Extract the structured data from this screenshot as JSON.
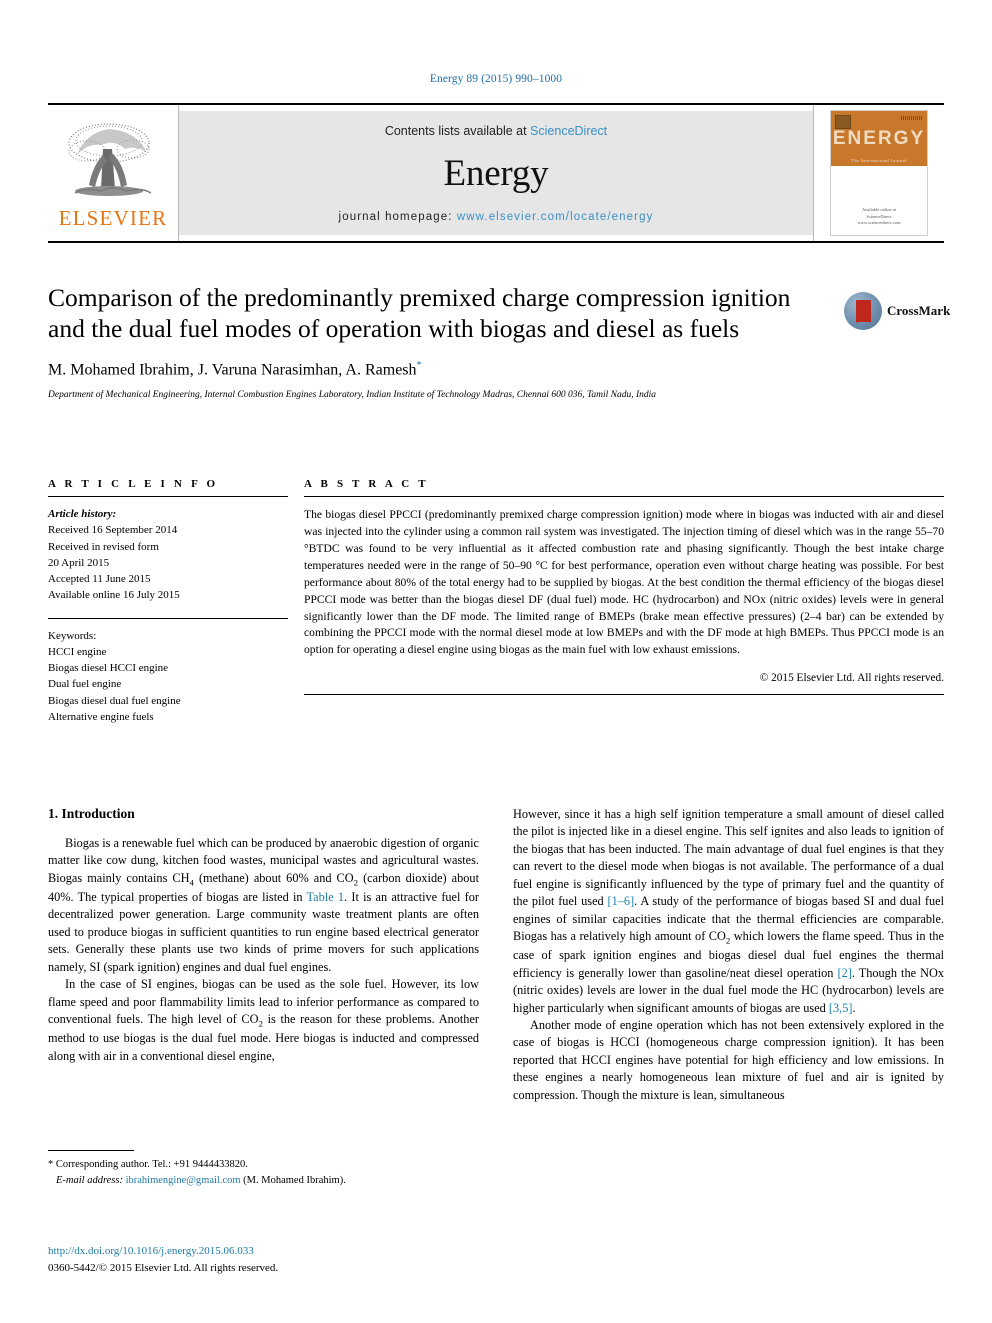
{
  "running_head": "Energy 89 (2015) 990–1000",
  "masthead": {
    "publisher_logo_text": "ELSEVIER",
    "contents_prefix": "Contents lists available at ",
    "contents_link": "ScienceDirect",
    "journal_name": "Energy",
    "homepage_prefix": "journal homepage: ",
    "homepage_url": "www.elsevier.com/locate/energy",
    "cover": {
      "title": "ENERGY",
      "subtitle": "The International Journal",
      "footer_line1": "Available online at",
      "footer_line2": "ScienceDirect",
      "footer_line3": "www.sciencedirect.com"
    }
  },
  "article": {
    "title": "Comparison of the predominantly premixed charge compression ignition and the dual fuel modes of operation with biogas and diesel as fuels",
    "crossmark_label": "CrossMark",
    "authors": "M. Mohamed Ibrahim, J. Varuna Narasimhan, A. Ramesh",
    "author_star": "*",
    "affiliation": "Department of Mechanical Engineering, Internal Combustion Engines Laboratory, Indian Institute of Technology Madras, Chennai 600 036, Tamil Nadu, India"
  },
  "info": {
    "heading": "A R T I C L E   I N F O",
    "history_label": "Article history:",
    "history": [
      "Received 16 September 2014",
      "Received in revised form",
      "20 April 2015",
      "Accepted 11 June 2015",
      "Available online 16 July 2015"
    ],
    "keywords_label": "Keywords:",
    "keywords": [
      "HCCI engine",
      "Biogas diesel HCCI engine",
      "Dual fuel engine",
      "Biogas diesel dual fuel engine",
      "Alternative engine fuels"
    ]
  },
  "abstract": {
    "heading": "A B S T R A C T",
    "text": "The biogas diesel PPCCI (predominantly premixed charge compression ignition) mode where in biogas was inducted with air and diesel was injected into the cylinder using a common rail system was investigated. The injection timing of diesel which was in the range 55–70 °BTDC was found to be very influential as it affected combustion rate and phasing significantly. Though the best intake charge temperatures needed were in the range of 50–90 °C for best performance, operation even without charge heating was possible. For best performance about 80% of the total energy had to be supplied by biogas. At the best condition the thermal efficiency of the biogas diesel PPCCI mode was better than the biogas diesel DF (dual fuel) mode. HC (hydrocarbon) and NOx (nitric oxides) levels were in general significantly lower than the DF mode. The limited range of BMEPs (brake mean effective pressures) (2–4 bar) can be extended by combining the PPCCI mode with the normal diesel mode at low BMEPs and with the DF mode at high BMEPs. Thus PPCCI mode is an option for operating a diesel engine using biogas as the main fuel with low exhaust emissions.",
    "copyright": "© 2015 Elsevier Ltd. All rights reserved."
  },
  "body": {
    "section_heading": "1. Introduction",
    "left_paragraphs": [
      {
        "pre": "Biogas is a renewable fuel which can be produced by anaerobic digestion of organic matter like cow dung, kitchen food wastes, municipal wastes and agricultural wastes. Biogas mainly contains CH",
        "sub1": "4",
        "mid1": " (methane) about 60% and CO",
        "sub2": "2",
        "mid2": " (carbon dioxide) about 40%. The typical properties of biogas are listed in ",
        "link": "Table 1",
        "post": ". It is an attractive fuel for decentralized power generation. Large community waste treatment plants are often used to produce biogas in sufficient quantities to run engine based electrical generator sets. Generally these plants use two kinds of prime movers for such applications namely, SI (spark ignition) engines and dual fuel engines."
      },
      {
        "pre": "In the case of SI engines, biogas can be used as the sole fuel. However, its low flame speed and poor flammability limits lead to inferior performance as compared to conventional fuels. The high level of CO",
        "sub1": "2",
        "post": " is the reason for these problems. Another method to use biogas is the dual fuel mode. Here biogas is inducted and compressed along with air in a conventional diesel engine,"
      }
    ],
    "right_paragraphs": [
      {
        "pre": "However, since it has a high self ignition temperature a small amount of diesel called the pilot is injected like in a diesel engine. This self ignites and also leads to ignition of the biogas that has been inducted. The main advantage of dual fuel engines is that they can revert to the diesel mode when biogas is not available. The performance of a dual fuel engine is significantly influenced by the type of primary fuel and the quantity of the pilot fuel used ",
        "link": "[1–6]",
        "mid1": ". A study of the performance of biogas based SI and dual fuel engines of similar capacities indicate that the thermal efficiencies are comparable. Biogas has a relatively high amount of CO",
        "sub1": "2",
        "mid2": " which lowers the flame speed. Thus in the case of spark ignition engines and biogas diesel dual fuel engines the thermal efficiency is generally lower than gasoline/neat diesel operation ",
        "link2": "[2]",
        "mid3": ". Though the NOx (nitric oxides) levels are lower in the dual fuel mode the HC (hydrocarbon) levels are higher particularly when significant amounts of biogas are used ",
        "link3": "[3,5]",
        "post": "."
      },
      {
        "pre": "Another mode of engine operation which has not been extensively explored in the case of biogas is HCCI (homogeneous charge compression ignition). It has been reported that HCCI engines have potential for high efficiency and low emissions. In these engines a nearly homogeneous lean mixture of fuel and air is ignited by compression. Though the mixture is lean, simultaneous"
      }
    ]
  },
  "footnote": {
    "star": "*",
    "corresponding": " Corresponding author. Tel.: +91 9444433820.",
    "email_label": "E-mail address:",
    "email": "ibrahimengine@gmail.com",
    "email_suffix": " (M. Mohamed Ibrahim)."
  },
  "footer": {
    "doi": "http://dx.doi.org/10.1016/j.energy.2015.06.033",
    "issn_line": "0360-5442/© 2015 Elsevier Ltd. All rights reserved."
  }
}
